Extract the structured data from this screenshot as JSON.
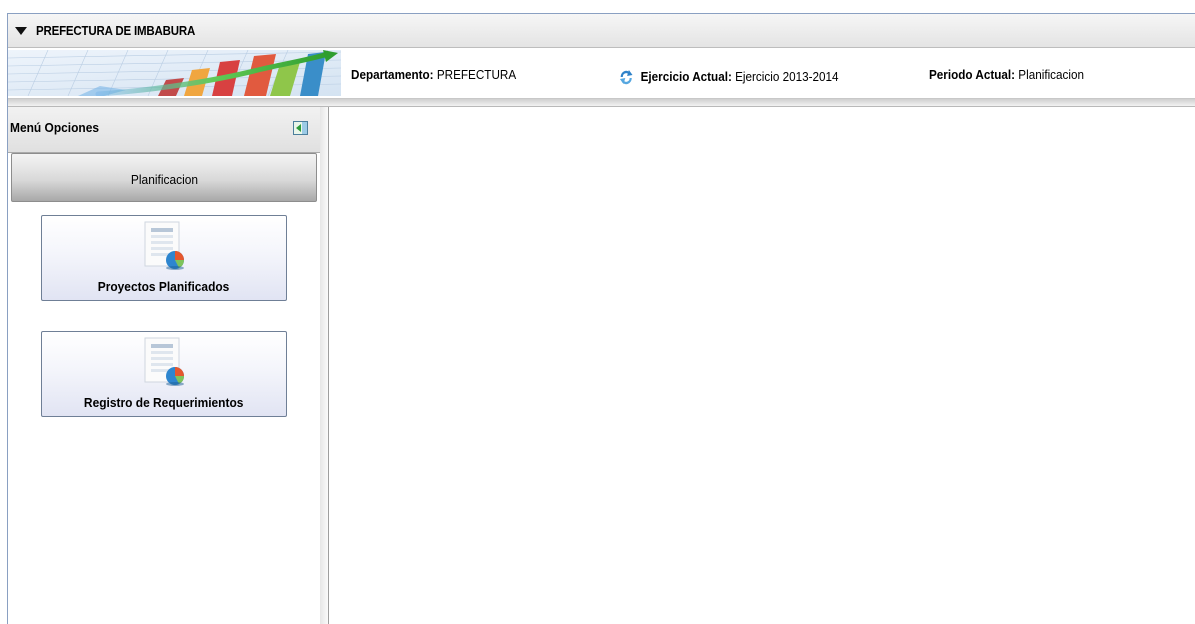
{
  "app": {
    "title": "PREFECTURA DE IMBABURA"
  },
  "header": {
    "departamento_label": "Departamento:",
    "departamento_value": "PREFECTURA",
    "ejercicio_label": "Ejercicio Actual:",
    "ejercicio_value": "Ejercicio 2013-2014",
    "periodo_label": "Periodo Actual:",
    "periodo_value": "Planificacion"
  },
  "sidebar": {
    "title": "Menú Opciones",
    "section": "Planificacion",
    "items": [
      {
        "label": "Proyectos Planificados",
        "icon": "report-chart-icon"
      },
      {
        "label": "Registro de Requerimientos",
        "icon": "report-chart-icon"
      }
    ]
  },
  "icons": {
    "title_bar": "collapse-arrow-icon",
    "refresh": "refresh-icon",
    "sidebar_collapse": "collapse-panel-icon"
  },
  "colors": {
    "frame_border": "#8aa0c2",
    "button_border": "#6f7f96",
    "button_gradient_end": "#e1e4f3"
  }
}
